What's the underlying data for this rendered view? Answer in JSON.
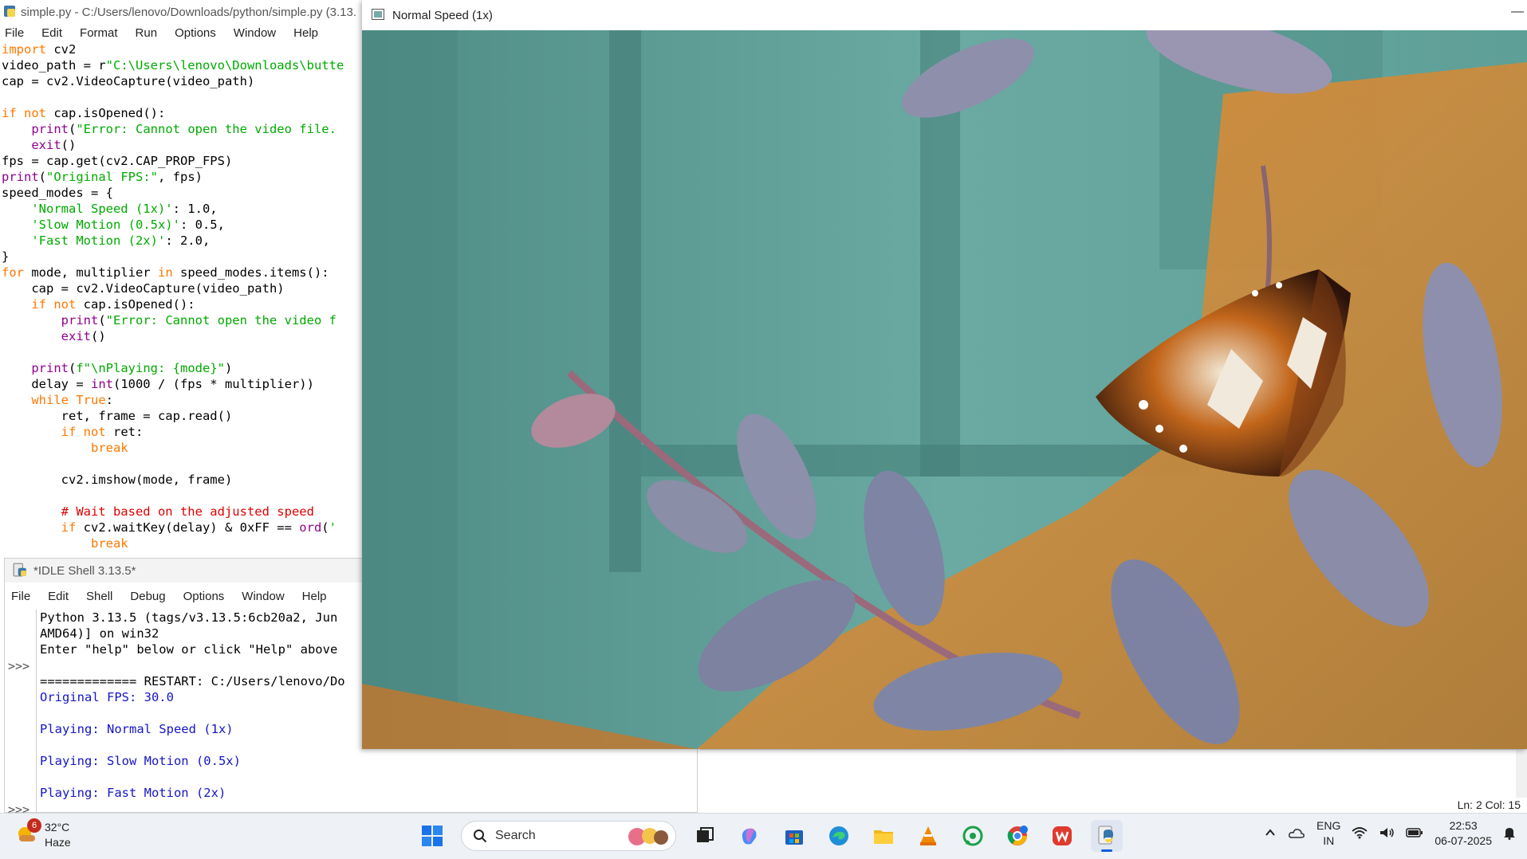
{
  "editor": {
    "title": "simple.py - C:/Users/lenovo/Downloads/python/simple.py (3.13.",
    "menu": [
      "File",
      "Edit",
      "Format",
      "Run",
      "Options",
      "Window",
      "Help"
    ]
  },
  "shell": {
    "title": "*IDLE Shell 3.13.5*",
    "menu": [
      "File",
      "Edit",
      "Shell",
      "Debug",
      "Options",
      "Window",
      "Help"
    ],
    "prompt": ">>>",
    "lines": [
      {
        "text": "Python 3.13.5 (tags/v3.13.5:6cb20a2, Jun",
        "style": "black"
      },
      {
        "text": "AMD64)] on win32",
        "style": "black"
      },
      {
        "text": "Enter \"help\" below or click \"Help\" above",
        "style": "black"
      },
      {
        "text": "",
        "style": "black"
      },
      {
        "text": "============= RESTART: C:/Users/lenovo/Do",
        "style": "black"
      },
      {
        "text": "Original FPS: 30.0",
        "style": "blue"
      },
      {
        "text": "",
        "style": "black"
      },
      {
        "text": "Playing: Normal Speed (1x)",
        "style": "blue"
      },
      {
        "text": "",
        "style": "black"
      },
      {
        "text": "Playing: Slow Motion (0.5x)",
        "style": "blue"
      },
      {
        "text": "",
        "style": "black"
      },
      {
        "text": "Playing: Fast Motion (2x)",
        "style": "blue"
      }
    ]
  },
  "code_lines": [
    [
      [
        "kw",
        "import"
      ],
      [
        "df",
        " cv2"
      ]
    ],
    [
      [
        "df",
        "video_path = r"
      ],
      [
        "st",
        "\"C:\\Users\\lenovo\\Downloads\\butte"
      ]
    ],
    [
      [
        "df",
        "cap = cv2.VideoCapture(video_path)"
      ]
    ],
    [],
    [
      [
        "kw",
        "if not"
      ],
      [
        "df",
        " cap.isOpened():"
      ]
    ],
    [
      [
        "df",
        "    "
      ],
      [
        "bi",
        "print"
      ],
      [
        "df",
        "("
      ],
      [
        "st",
        "\"Error: Cannot open the video file."
      ]
    ],
    [
      [
        "df",
        "    "
      ],
      [
        "bi",
        "exit"
      ],
      [
        "df",
        "()"
      ]
    ],
    [
      [
        "df",
        "fps = cap.get(cv2.CAP_PROP_FPS)"
      ]
    ],
    [
      [
        "bi",
        "print"
      ],
      [
        "df",
        "("
      ],
      [
        "st",
        "\"Original FPS:\""
      ],
      [
        "df",
        ", fps)"
      ]
    ],
    [
      [
        "df",
        "speed_modes = {"
      ]
    ],
    [
      [
        "df",
        "    "
      ],
      [
        "st",
        "'Normal Speed (1x)'"
      ],
      [
        "df",
        ": 1.0,"
      ]
    ],
    [
      [
        "df",
        "    "
      ],
      [
        "st",
        "'Slow Motion (0.5x)'"
      ],
      [
        "df",
        ": 0.5,"
      ]
    ],
    [
      [
        "df",
        "    "
      ],
      [
        "st",
        "'Fast Motion (2x)'"
      ],
      [
        "df",
        ": 2.0,"
      ]
    ],
    [
      [
        "df",
        "}"
      ]
    ],
    [
      [
        "kw",
        "for"
      ],
      [
        "df",
        " mode, multiplier "
      ],
      [
        "kw",
        "in"
      ],
      [
        "df",
        " speed_modes.items():"
      ]
    ],
    [
      [
        "df",
        "    cap = cv2.VideoCapture(video_path)"
      ]
    ],
    [
      [
        "df",
        "    "
      ],
      [
        "kw",
        "if not"
      ],
      [
        "df",
        " cap.isOpened():"
      ]
    ],
    [
      [
        "df",
        "        "
      ],
      [
        "bi",
        "print"
      ],
      [
        "df",
        "("
      ],
      [
        "st",
        "\"Error: Cannot open the video f"
      ]
    ],
    [
      [
        "df",
        "        "
      ],
      [
        "bi",
        "exit"
      ],
      [
        "df",
        "()"
      ]
    ],
    [],
    [
      [
        "df",
        "    "
      ],
      [
        "bi",
        "print"
      ],
      [
        "df",
        "("
      ],
      [
        "st",
        "f\"\\nPlaying: {mode}\""
      ],
      [
        "df",
        ")"
      ]
    ],
    [
      [
        "df",
        "    delay = "
      ],
      [
        "bi",
        "int"
      ],
      [
        "df",
        "(1000 / (fps * multiplier))"
      ]
    ],
    [
      [
        "df",
        "    "
      ],
      [
        "kw",
        "while True"
      ],
      [
        "df",
        ":"
      ]
    ],
    [
      [
        "df",
        "        ret, frame = cap.read()"
      ]
    ],
    [
      [
        "df",
        "        "
      ],
      [
        "kw",
        "if not"
      ],
      [
        "df",
        " ret:"
      ]
    ],
    [
      [
        "df",
        "            "
      ],
      [
        "kw",
        "break"
      ]
    ],
    [],
    [
      [
        "df",
        "        cv2.imshow(mode, frame)"
      ]
    ],
    [],
    [
      [
        "df",
        "        "
      ],
      [
        "cm",
        "# Wait based on the adjusted speed"
      ]
    ],
    [
      [
        "df",
        "        "
      ],
      [
        "kw",
        "if"
      ],
      [
        "df",
        " cv2.waitKey(delay) & 0xFF == "
      ],
      [
        "bi",
        "ord"
      ],
      [
        "df",
        "("
      ],
      [
        "st",
        "'"
      ]
    ],
    [
      [
        "df",
        "            "
      ],
      [
        "kw",
        "break"
      ]
    ]
  ],
  "video_window": {
    "title": "Normal Speed (1x)",
    "minimize": "—"
  },
  "status": {
    "text": "Ln: 2   Col: 15"
  },
  "taskbar": {
    "weather_temp": "32°C",
    "weather_desc": "Haze",
    "weather_badge": "6",
    "search_placeholder": "Search",
    "lang_top": "ENG",
    "lang_bottom": "IN",
    "time": "22:53",
    "date": "06-07-2025"
  },
  "colors": {
    "keyword": "#ff7700",
    "builtin": "#900090",
    "string": "#00aa00",
    "comment": "#dd0000",
    "shell_output": "#1515c7"
  }
}
